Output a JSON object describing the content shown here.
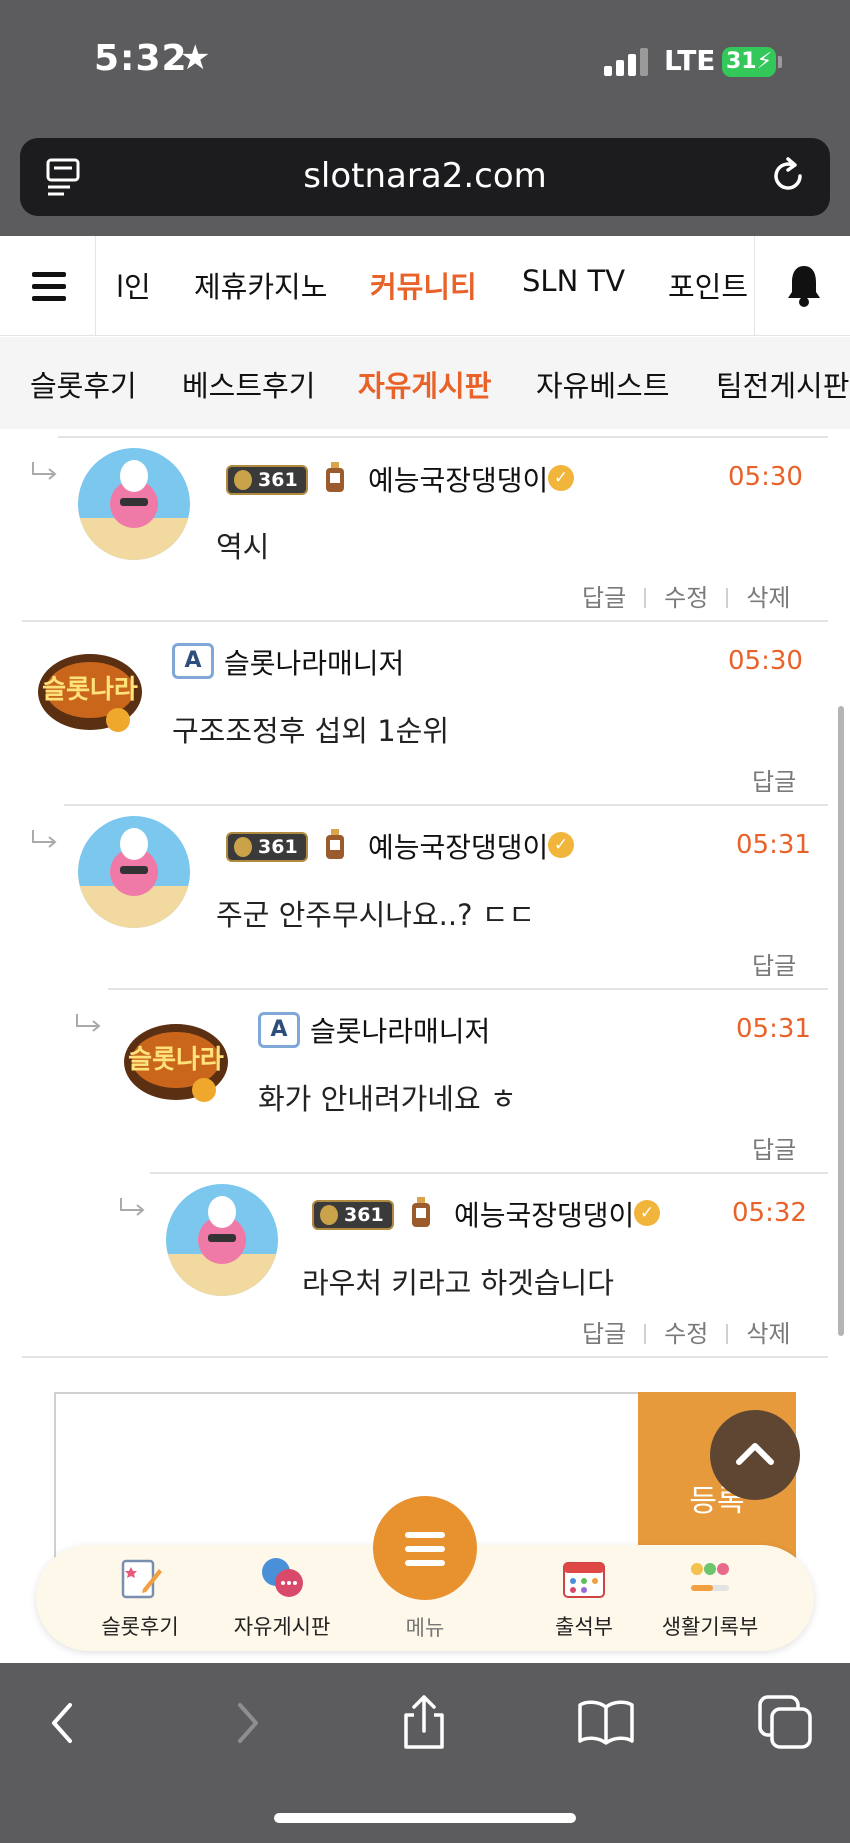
{
  "status": {
    "time": "5:32",
    "network": "LTE",
    "battery": "31"
  },
  "browser": {
    "url": "slotnara2.com"
  },
  "main_nav": {
    "items": [
      {
        "label": "l인",
        "active": false
      },
      {
        "label": "제휴카지노",
        "active": false
      },
      {
        "label": "커뮤니티",
        "active": true
      },
      {
        "label": "SLN TV",
        "active": false
      },
      {
        "label": "포인트",
        "active": false
      }
    ]
  },
  "sub_nav": {
    "items": [
      {
        "label": "슬롯후기",
        "active": false
      },
      {
        "label": "베스트후기",
        "active": false
      },
      {
        "label": "자유게시판",
        "active": true
      },
      {
        "label": "자유베스트",
        "active": false
      },
      {
        "label": "팀전게시판",
        "active": false
      }
    ]
  },
  "comments": [
    {
      "author": "예능국장댕댕이",
      "level": "361",
      "time": "05:30",
      "content": "역시",
      "actions": [
        "답글",
        "수정",
        "삭제"
      ]
    },
    {
      "author": "슬롯나라매니저",
      "admin_badge": "A",
      "time": "05:30",
      "content": "구조조정후 섭외 1순위",
      "actions": [
        "답글"
      ]
    },
    {
      "author": "예능국장댕댕이",
      "level": "361",
      "time": "05:31",
      "content": "주군 안주무시나요..? ㄷㄷ",
      "actions": [
        "답글"
      ]
    },
    {
      "author": "슬롯나라매니저",
      "admin_badge": "A",
      "time": "05:31",
      "content": "화가 안내려가네요 ㅎ",
      "actions": [
        "답글"
      ]
    },
    {
      "author": "예능국장댕댕이",
      "level": "361",
      "time": "05:32",
      "content": "라우처 키라고 하겟습니다",
      "actions": [
        "답글",
        "수정",
        "삭제"
      ]
    }
  ],
  "comment_form": {
    "submit_label": "등록"
  },
  "bottom_menu": {
    "items": [
      "슬롯후기",
      "자유게시판",
      "메뉴",
      "출석부",
      "생활기록부"
    ]
  },
  "colors": {
    "accent": "#e8622a",
    "orange_button": "#e79a3c",
    "chrome": "#5c5c5e"
  }
}
